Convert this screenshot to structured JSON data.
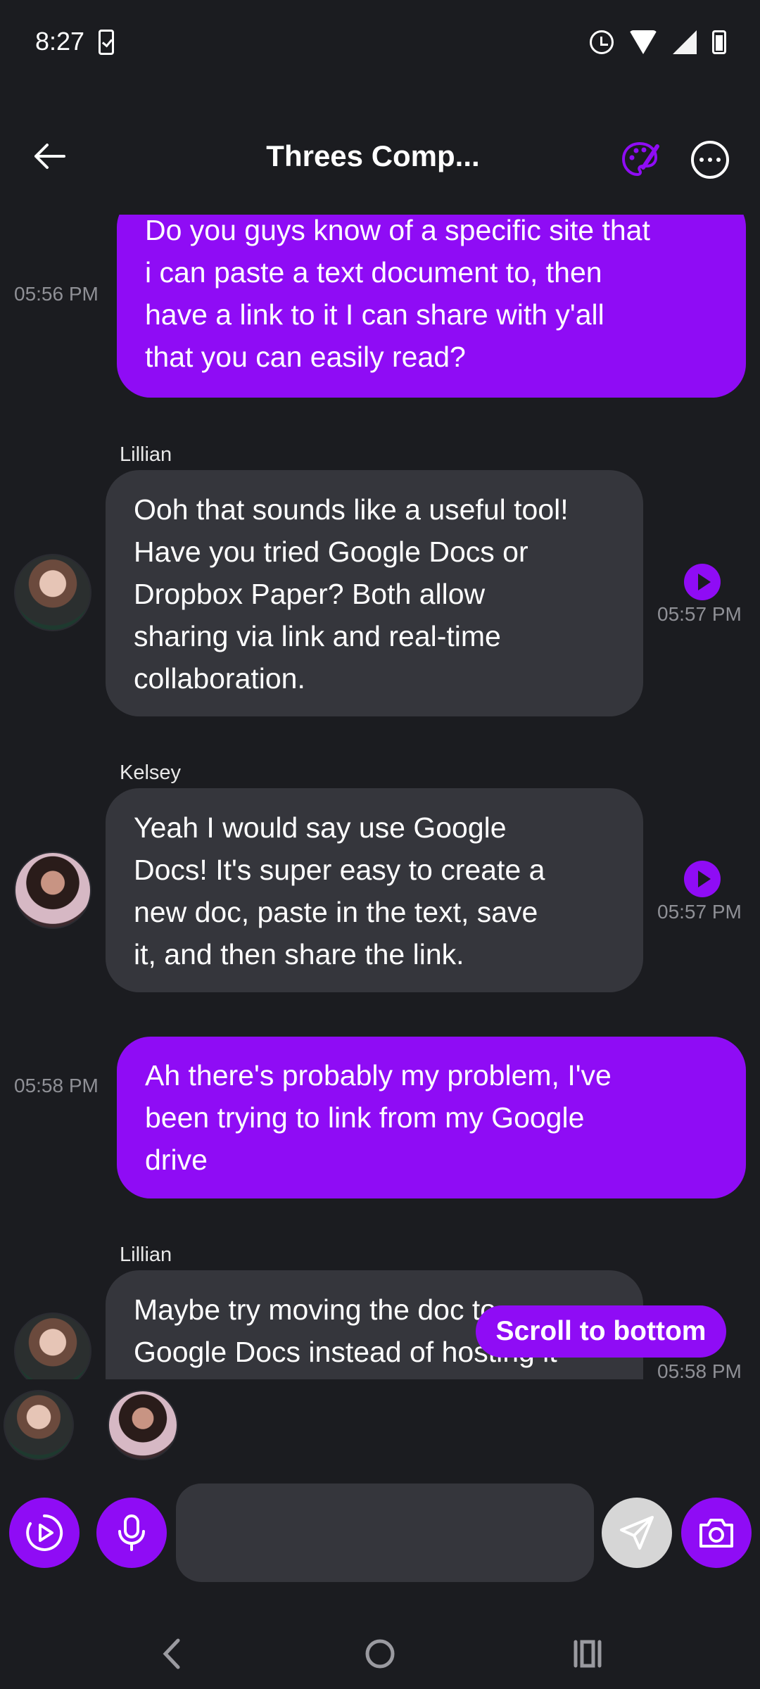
{
  "status_bar": {
    "time": "8:27",
    "icons": [
      "task-done-icon",
      "alarm-icon",
      "wifi-icon",
      "signal-icon",
      "battery-icon"
    ]
  },
  "header": {
    "title": "Threes Comp...",
    "back_icon": "arrow-left-icon",
    "palette_icon": "palette-icon",
    "more_icon": "more-horizontal-icon"
  },
  "messages": [
    {
      "author": "me",
      "text_lines": [
        "Do you guys know of a specific site that",
        "i can paste a text document to, then",
        "have a link to it I can share with y'all",
        "that you can easily read?"
      ],
      "time": "05:56 PM"
    },
    {
      "author": "Lillian",
      "text_lines": [
        "Ooh that sounds like a useful tool!",
        "Have you tried Google Docs or",
        "Dropbox Paper? Both allow",
        "sharing via link and real-time",
        "collaboration."
      ],
      "time": "05:57 PM"
    },
    {
      "author": "Kelsey",
      "text_lines": [
        "Yeah I would say use Google",
        "Docs! It's super easy to create a",
        "new doc, paste in the text, save",
        "it, and then share the link."
      ],
      "time": "05:57 PM"
    },
    {
      "author": "me",
      "text_lines": [
        "Ah there's probably my problem, I've",
        "been trying to link from my Google",
        "drive"
      ],
      "time": "05:58 PM"
    },
    {
      "author": "Lillian",
      "text_lines": [
        "Maybe try moving the doc to",
        "Google Docs instead of hosting it"
      ],
      "time": "05:58 PM"
    }
  ],
  "scroll_to_bottom_label": "Scroll to bottom",
  "composer": {
    "input_value": "",
    "input_placeholder": ""
  },
  "colors": {
    "accent": "#8f0cf5",
    "background": "#1b1c20",
    "bubble_theirs": "#35363c",
    "timestamp": "#8f9096"
  }
}
